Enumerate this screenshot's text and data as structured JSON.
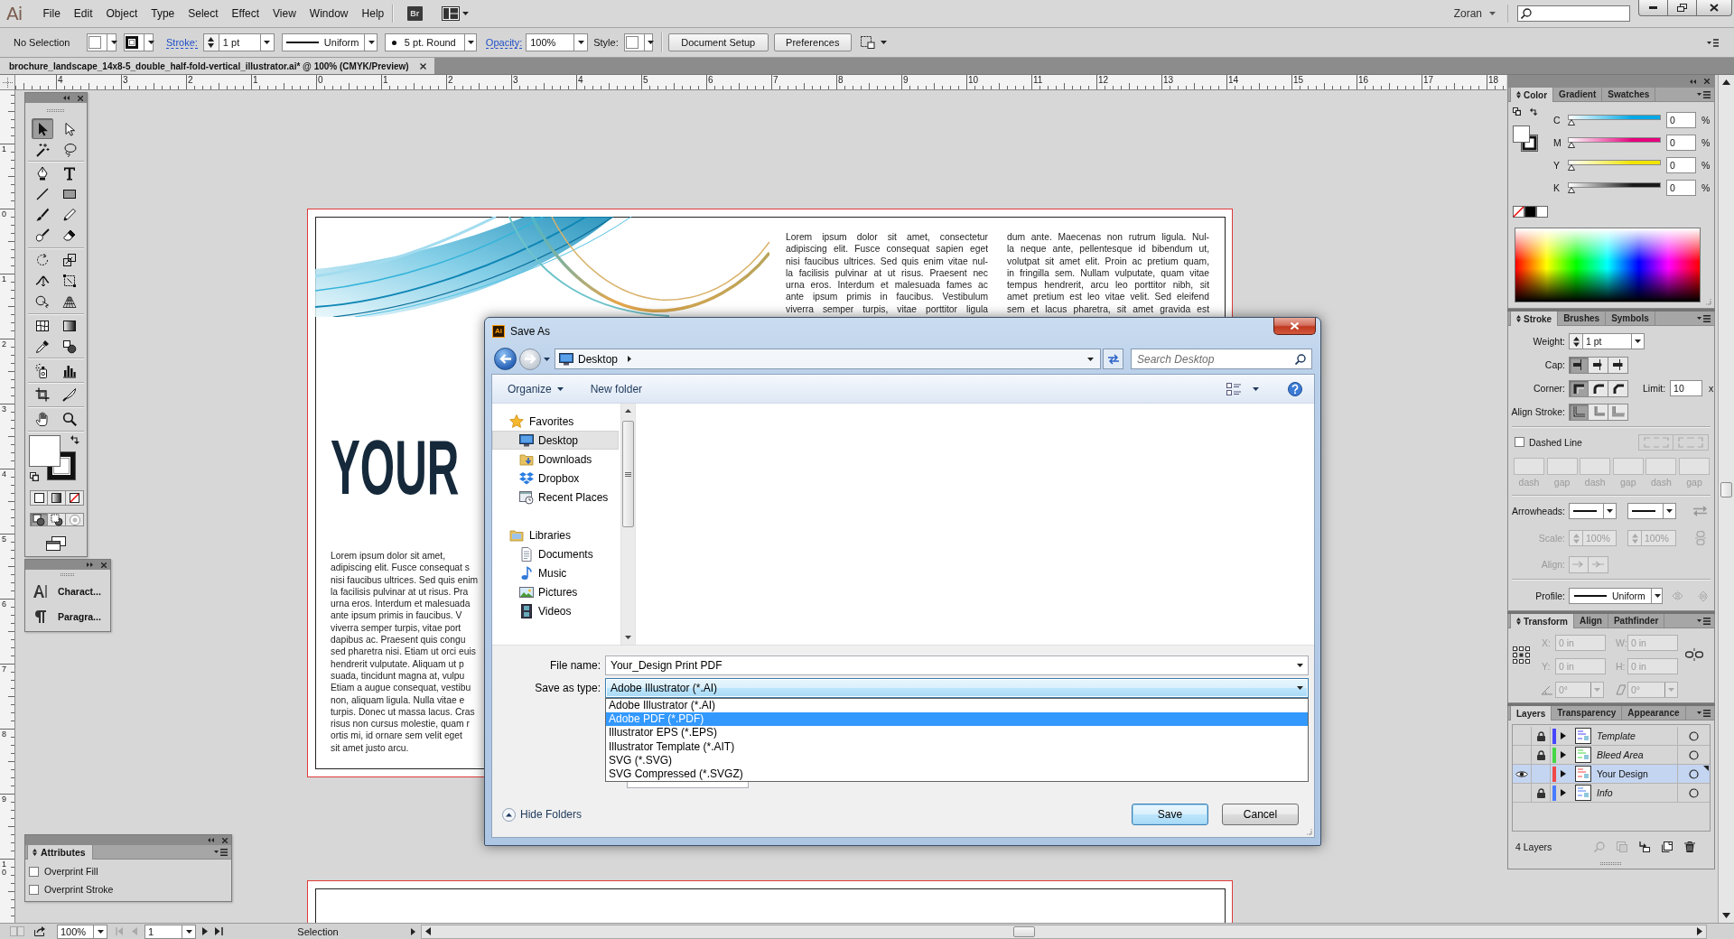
{
  "app": {
    "logo": "Ai",
    "menus": [
      "File",
      "Edit",
      "Object",
      "Type",
      "Select",
      "Effect",
      "View",
      "Window",
      "Help"
    ],
    "bridge": "Br",
    "user": "Zoran"
  },
  "control_bar": {
    "selection": "No Selection",
    "stroke_label": "Stroke:",
    "stroke_weight": "1 pt",
    "stroke_profile": "Uniform",
    "brush": "5 pt. Round",
    "opacity_label": "Opacity:",
    "opacity": "100%",
    "style_label": "Style:",
    "buttons": [
      "Document Setup",
      "Preferences"
    ]
  },
  "document_tab": {
    "title": "brochure_landscape_14x8-5_double_half-fold-vertical_illustrator.ai* @ 100% (CMYK/Preview)"
  },
  "rulers": {
    "horizontal": [
      "4",
      "3",
      "2",
      "1",
      "0",
      "1",
      "2",
      "3",
      "4",
      "5",
      "6",
      "7",
      "8",
      "9",
      "10",
      "11",
      "12",
      "13",
      "14",
      "15",
      "16",
      "17",
      "18"
    ],
    "vertical": [
      "1",
      "0",
      "1",
      "2",
      "3",
      "4",
      "5",
      "6",
      "7",
      "8",
      "9",
      "10"
    ]
  },
  "tools": [
    [
      {
        "kind": "selection",
        "selected": true
      },
      {
        "kind": "direct-selection",
        "selected": false
      },
      {
        "kind": "magic-wand",
        "selected": false
      },
      {
        "kind": "lasso",
        "selected": false
      }
    ],
    [
      {
        "kind": "pen",
        "selected": false
      },
      {
        "kind": "type",
        "selected": false
      },
      {
        "kind": "line",
        "selected": false
      },
      {
        "kind": "rectangle",
        "selected": false
      },
      {
        "kind": "paintbrush",
        "selected": false
      },
      {
        "kind": "pencil",
        "selected": false
      },
      {
        "kind": "blob-brush",
        "selected": false
      },
      {
        "kind": "eraser",
        "selected": false
      }
    ],
    [
      {
        "kind": "rotate",
        "selected": false
      },
      {
        "kind": "scale",
        "selected": false
      },
      {
        "kind": "width",
        "selected": false
      },
      {
        "kind": "free-transform",
        "selected": false
      },
      {
        "kind": "shape-builder",
        "selected": false
      },
      {
        "kind": "perspective-grid",
        "selected": false
      }
    ],
    [
      {
        "kind": "mesh",
        "selected": false
      },
      {
        "kind": "gradient",
        "selected": false
      },
      {
        "kind": "eyedropper",
        "selected": false
      },
      {
        "kind": "blend",
        "selected": false
      }
    ],
    [
      {
        "kind": "symbol-sprayer",
        "selected": false
      },
      {
        "kind": "column-graph",
        "selected": false
      }
    ],
    [
      {
        "kind": "artboard",
        "selected": false
      },
      {
        "kind": "slice",
        "selected": false
      }
    ],
    [
      {
        "kind": "hand",
        "selected": false
      },
      {
        "kind": "zoom",
        "selected": false
      }
    ]
  ],
  "draw_modes": [
    {
      "kind": "normal",
      "selected": true
    },
    {
      "kind": "behind",
      "selected": false
    },
    {
      "kind": "inside",
      "selected": false
    }
  ],
  "mini_panel": {
    "items": [
      {
        "kind": "character",
        "label": "Charact..."
      },
      {
        "kind": "paragraph",
        "label": "Paragra..."
      }
    ]
  },
  "attributes_panel": {
    "tabs": [
      {
        "label": "Attributes",
        "selected": true
      }
    ],
    "options_toggle": true,
    "options": [
      {
        "label": "Overprint Fill",
        "checked": false
      },
      {
        "label": "Overprint Stroke",
        "checked": false
      }
    ]
  },
  "artboard": {
    "heading": "YOUR",
    "left_column": [
      "Lorem ipsum dolor sit amet,",
      "adipiscing elit. Fusce consequat s",
      "nisi faucibus ultrices. Sed quis enim",
      "la facilisis pulvinar at ut risus. Pra",
      "urna eros. Interdum et malesuada",
      "ante ipsum primis in faucibus. V",
      "viverra semper turpis, vitae port",
      "dapibus ac. Praesent quis congu",
      "sed pharetra nisi. Etiam ut orci euis",
      "hendrerit vulputate. Aliquam ut p",
      "suada, tincidunt magna at, vulpu",
      "Etiam a augue consequat, vestibu",
      "non, aliquam ligula. Nulla vitae e",
      "turpis. Donec ut massa lacus. Cras",
      "risus non cursus molestie, quam r",
      "ortis mi, id ornare sem velit eget",
      "sit amet justo arcu."
    ],
    "columns": [
      [
        "Lorem ipsum dolor sit amet, consectetur",
        "adipiscing elit. Fusce consequat sapien eget",
        "nisi faucibus ultrices. Sed quis enim vitae nul-",
        "la facilisis pulvinar at ut risus. Praesent nec",
        "urna eros. Interdum et malesuada fames ac",
        "ante ipsum primis in faucibus. Vestibulum",
        "viverra semper turpis, vitae porttitor ligula"
      ],
      [
        "dum ante. Maecenas non rutrum ligula. Nul-",
        "la neque ante, pellentesque id bibendum ut,",
        "volutpat sit amet elit. Proin ac pretium quam,",
        "in fringilla sem. Nullam vulputate, quam vitae",
        "tempus hendrerit, arcu leo porttitor nibh, sit",
        "amet pretium est leo vitae velit. Sed eleifend",
        "sem et lacus pharetra, sit amet gravida est"
      ]
    ]
  },
  "dock": {
    "color": {
      "tabs": [
        {
          "label": "Color",
          "selected": true
        },
        {
          "label": "Gradient",
          "selected": false
        },
        {
          "label": "Swatches",
          "selected": false
        }
      ],
      "options_toggle": true,
      "channels": [
        {
          "name": "C",
          "color": "#00a8e6",
          "level": 0,
          "value": "0",
          "unit": "%"
        },
        {
          "name": "M",
          "color": "#e6007e",
          "level": 0,
          "value": "0",
          "unit": "%"
        },
        {
          "name": "Y",
          "color": "#f0e400",
          "level": 0,
          "value": "0",
          "unit": "%"
        },
        {
          "name": "K",
          "color": "#1a1a1a",
          "level": 0,
          "value": "0",
          "unit": "%"
        }
      ]
    },
    "stroke": {
      "tabs": [
        {
          "label": "Stroke",
          "selected": true
        },
        {
          "label": "Brushes",
          "selected": false
        },
        {
          "label": "Symbols",
          "selected": false
        }
      ],
      "options_toggle": true,
      "weight_label": "Weight:",
      "weight": "1 pt",
      "cap_label": "Cap:",
      "caps": [
        {
          "kind": "butt",
          "selected": true
        },
        {
          "kind": "round",
          "selected": false
        },
        {
          "kind": "projecting",
          "selected": false
        }
      ],
      "corner_label": "Corner:",
      "corners": [
        {
          "kind": "miter",
          "selected": true
        },
        {
          "kind": "round",
          "selected": false
        },
        {
          "kind": "bevel",
          "selected": false
        }
      ],
      "limit_label": "Limit:",
      "limit": "10",
      "limit_unit": "x",
      "align_label": "Align Stroke:",
      "aligns": [
        {
          "kind": "center",
          "selected": true
        },
        {
          "kind": "inside",
          "selected": false
        },
        {
          "kind": "outside",
          "selected": false
        }
      ],
      "dashed_line": {
        "label": "Dashed Line",
        "checked": false,
        "disabled": true,
        "fields": [
          "dash",
          "gap",
          "dash",
          "gap",
          "dash",
          "gap"
        ]
      },
      "arrowheads_label": "Arrowheads:",
      "scale": {
        "label": "Scale:",
        "values": [
          "100%",
          "100%"
        ],
        "disabled": true
      },
      "align": {
        "label": "Align:",
        "disabled": true
      },
      "profile_label": "Profile:",
      "profile": "Uniform"
    },
    "transform": {
      "tabs": [
        {
          "label": "Transform",
          "selected": true
        },
        {
          "label": "Align",
          "selected": false
        },
        {
          "label": "Pathfinder",
          "selected": false
        }
      ],
      "options_toggle": true,
      "disabled": true,
      "fields": [
        {
          "label": "X:",
          "value": "0 in"
        },
        {
          "label": "W:",
          "value": "0 in"
        },
        {
          "label": "Y:",
          "value": "0 in"
        },
        {
          "label": "H:",
          "value": "0 in"
        }
      ],
      "angles": [
        {
          "kind": "rotate",
          "value": "0°"
        },
        {
          "kind": "shear",
          "value": "0°"
        }
      ]
    },
    "layers": {
      "tabs": [
        {
          "label": "Layers",
          "selected": true
        },
        {
          "label": "Transparency",
          "selected": false
        },
        {
          "label": "Appearance",
          "selected": false
        }
      ],
      "rows": [
        {
          "name": "Template",
          "color": "#4646ff",
          "visible": false,
          "locked": true,
          "printing": false,
          "selected": false
        },
        {
          "name": "Bleed Area",
          "color": "#45d845",
          "visible": false,
          "locked": true,
          "printing": false,
          "selected": false
        },
        {
          "name": "Your Design",
          "color": "#f04848",
          "visible": true,
          "locked": false,
          "printing": true,
          "selected": true
        },
        {
          "name": "Info",
          "color": "#4a7cff",
          "visible": false,
          "locked": true,
          "printing": false,
          "selected": false
        }
      ],
      "count": "4 Layers"
    }
  },
  "status_bar": {
    "zoom": "100%",
    "page": "1",
    "tool": "Selection"
  },
  "save_dialog": {
    "app_icon": "Ai",
    "title": "Save As",
    "location": "Desktop",
    "search_placeholder": "Search Desktop",
    "organize": "Organize",
    "new_folder": "New folder",
    "nav": [
      {
        "label": "Favorites",
        "kind": "favorites",
        "selected": false,
        "children": [
          {
            "label": "Desktop",
            "kind": "desktop",
            "selected": true
          },
          {
            "label": "Downloads",
            "kind": "downloads",
            "selected": false
          },
          {
            "label": "Dropbox",
            "kind": "dropbox",
            "selected": false
          },
          {
            "label": "Recent Places",
            "kind": "recent",
            "selected": false
          }
        ]
      },
      {
        "label": "Libraries",
        "kind": "libraries",
        "selected": false,
        "children": [
          {
            "label": "Documents",
            "kind": "documents",
            "selected": false
          },
          {
            "label": "Music",
            "kind": "music",
            "selected": false
          },
          {
            "label": "Pictures",
            "kind": "pictures",
            "selected": false
          },
          {
            "label": "Videos",
            "kind": "videos",
            "selected": false
          }
        ]
      }
    ],
    "file_name_label": "File name:",
    "file_name": "Your_Design Print PDF",
    "type_label": "Save as type:",
    "type_value": "Adobe Illustrator (*.AI)",
    "type_options": [
      {
        "label": "Adobe Illustrator (*.AI)",
        "selected": false
      },
      {
        "label": "Adobe PDF (*.PDF)",
        "selected": true
      },
      {
        "label": "Illustrator EPS (*.EPS)",
        "selected": false
      },
      {
        "label": "Illustrator Template (*.AIT)",
        "selected": false
      },
      {
        "label": "SVG (*.SVG)",
        "selected": false
      },
      {
        "label": "SVG Compressed (*.SVGZ)",
        "selected": false
      }
    ],
    "hide_folders": "Hide Folders",
    "buttons": [
      {
        "label": "Save",
        "default": true
      },
      {
        "label": "Cancel",
        "default": false
      }
    ]
  }
}
